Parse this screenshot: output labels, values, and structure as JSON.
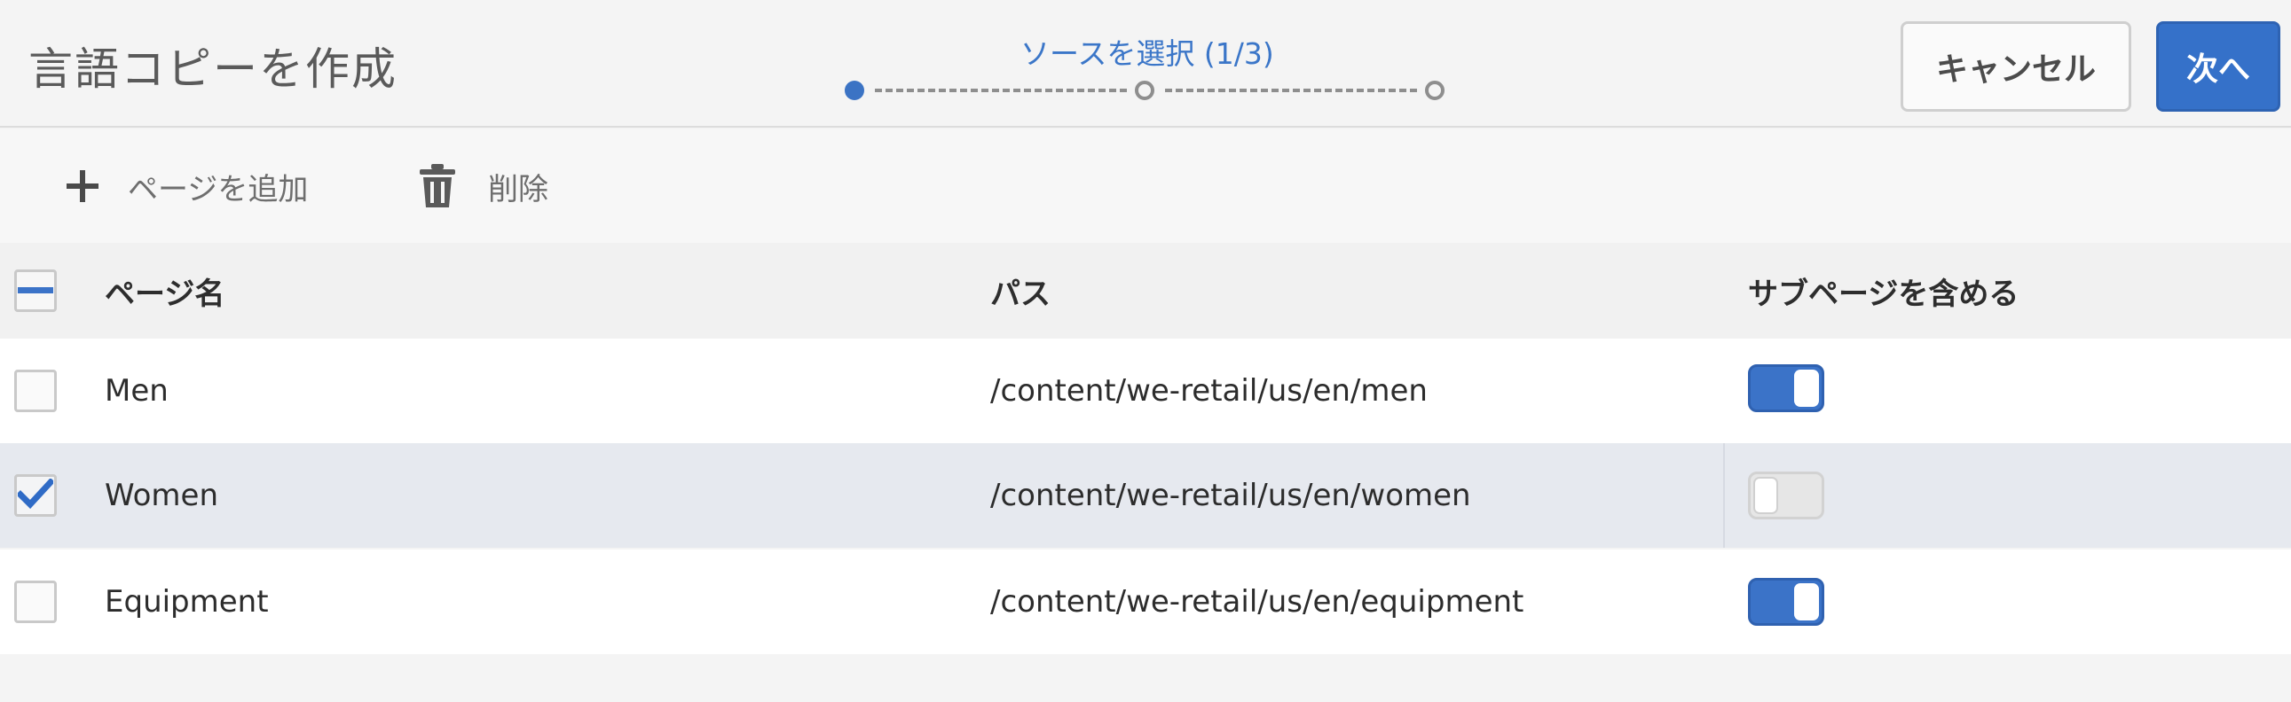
{
  "header": {
    "title": "言語コピーを作成",
    "wizard_step": "ソースを選択 (1/3)",
    "cancel_label": "キャンセル",
    "next_label": "次へ"
  },
  "toolbar": {
    "add_label": "ページを追加",
    "delete_label": "削除"
  },
  "table": {
    "columns": [
      "ページ名",
      "パス",
      "サブページを含める"
    ],
    "rows": [
      {
        "name": "Men",
        "path": "/content/we-retail/us/en/men",
        "checked": false,
        "include_subpages": true
      },
      {
        "name": "Women",
        "path": "/content/we-retail/us/en/women",
        "checked": true,
        "include_subpages": false
      },
      {
        "name": "Equipment",
        "path": "/content/we-retail/us/en/equipment",
        "checked": false,
        "include_subpages": true
      }
    ]
  },
  "colors": {
    "accent": "#3571c9",
    "selected_row": "#e6e9ef"
  },
  "icons": [
    "plus-icon",
    "trash-icon",
    "checkmark-icon",
    "minus-icon"
  ]
}
